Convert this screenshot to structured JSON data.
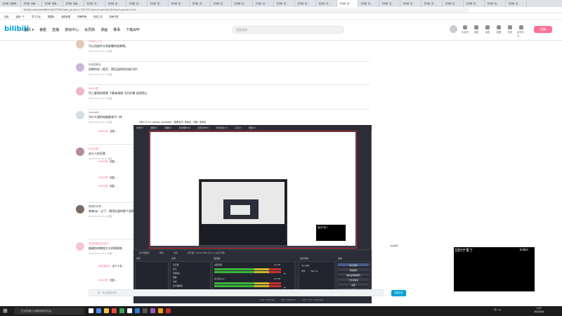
{
  "browser": {
    "tabs": [
      "【日常】直播录…",
      "【日常】直播…",
      "【日常】直播…",
      "【日常】直播…",
      "【日常】直…",
      "【日常】直…",
      "【日常】直…",
      "【日常】直…",
      "【日常】直…",
      "【日常】直…",
      "【日常】直…",
      "【日常】直…",
      "【日常】直…",
      "【日常】直…",
      "【日常】直…",
      "【日常】直…",
      "【日常】直…",
      "【日常】直…",
      "【日常】直…",
      "【日常】直…",
      "【日常】直…",
      "【日常】直…",
      "【日常】直…",
      "【日常】直…",
      "【日常】直…"
    ],
    "url": "bilibili.com/video/BV1mAU7F9K/?spm_id_from=333.337.search-card.all.click&vd_source=1c2e",
    "bookmarks": [
      "应用",
      "百度一下",
      "学习平台",
      "数据库",
      "我的收藏",
      "哔哩哔哩",
      "在线工具",
      "其他书签"
    ]
  },
  "bili": {
    "logo": "bilibili",
    "nav": [
      "首页 ▾",
      "番剧",
      "直播",
      "游戏中心",
      "会员购",
      "漫画",
      "赛事",
      "下载APP"
    ],
    "search_placeholder": "搜索视频",
    "right_nav": [
      "大会员",
      "消息",
      "动态",
      "收藏",
      "历史",
      "创作中心"
    ],
    "upload": "投稿"
  },
  "comments": [
    {
      "name": "Zhan1_13",
      "text": "可以用软件分享屏幕的效果啊。",
      "meta": "2022-03-01 19:41  回复"
    },
    {
      "name": "米哈游粉丝",
      "text": "如果你在一直开，然后这样的应该行吗？",
      "meta": "2022-03-01 19:41  回复"
    },
    {
      "name": "bilibili君",
      "text": "早上看到的视频 下载来录屏 大约好像 居然停止",
      "meta": "2022-03-01 19:41  回复"
    },
    {
      "name": "yuzupeh",
      "text": "为什么我的电脑都录不一样",
      "meta": "2022-03-01 19:41  回复"
    },
    {
      "name": "bilibili君",
      "text": "这么人好厉害",
      "meta": "2022-03-01 19:41  回复"
    },
    {
      "name": "像素的深夜",
      "text": "来来up：过了，就用右面的那个选择录制就好啦",
      "meta": "2022-03-01 19:41  回复"
    },
    {
      "name": "哈哈哈哈哈的自己",
      "text": "感谢你的教程大大的帮助啦",
      "meta": "2022-03-01 19:41  回复"
    }
  ],
  "replies": [
    {
      "name": "bilibili君",
      "text": "这是…"
    },
    {
      "name": "bilibili君",
      "text": "回复 …"
    },
    {
      "name": "bilibili君",
      "text": "回复 …"
    },
    {
      "name": "bilibili君",
      "text": "回复 …"
    },
    {
      "name": "米哈游粉丝",
      "text": "这个人怎…"
    },
    {
      "name": "bilibili君",
      "text": "回复 …"
    }
  ],
  "obs": {
    "title": "OBS 27.2.1 (64-bit, windows) - 配置文件: 未命名 - 场景: 未命名",
    "menu": [
      "文件(F)",
      "编辑(E)",
      "视图(V)",
      "停靠部件(D)",
      "配置文件(P)",
      "场景集合(S)",
      "工具(T)",
      "帮助(H)"
    ],
    "status_row": [
      "显示器捕获",
      "属性",
      "滤镜",
      "显示器: 1920x1080 @ 0,0 (主显示器)"
    ],
    "docks": [
      "场景",
      "来源",
      "混音器",
      "场景转换",
      "控制"
    ],
    "sources": [
      "显示器",
      "窗口",
      "音频输入",
      "图像",
      "文本",
      "显示器捕获"
    ],
    "mixer_labels": [
      "桌面音频",
      "麦克风/Aux"
    ],
    "mixer_db": "0.0 dB",
    "transition": "淡入淡出",
    "duration_label": "时长",
    "duration": "300 ms",
    "controls": [
      "停止录制",
      "开始推流",
      "启动虚拟摄像机",
      "工作室模式",
      "设置",
      "退出"
    ],
    "footer": [
      "LIVE: 00:00:00",
      "REC: 00:00:25",
      "CPU: 3.1%, 30.00 fps"
    ],
    "blackbox_text": "回归于录了"
  },
  "overlay": {
    "title": "回归于录了",
    "logo": "bilibili"
  },
  "right_mini": "本站推荐",
  "reply_input_placeholder": "发一条友善的评论",
  "send_label": "发表评论",
  "taskbar": {
    "search_placeholder": "在这里输入你要搜索的内容",
    "tray": "^ 英 ⊙ 🔈",
    "time": "1:47",
    "date": "2022/3/4"
  },
  "colors": {
    "brand": "#00a1d6",
    "pink": "#fb7299",
    "obs_bg": "#2b2e38",
    "record_red": "#c8262e"
  }
}
